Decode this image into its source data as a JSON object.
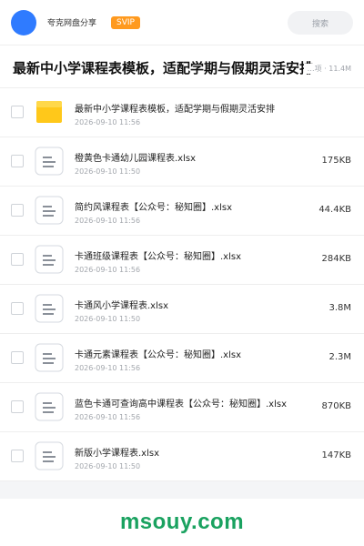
{
  "header": {
    "app_name": "夸克网盘分享",
    "badge": "SVIP",
    "search_label": "搜索"
  },
  "share": {
    "title": "最新中小学课程表模板，适配学期与假期灵活安排",
    "meta": "…项 · 11.4M"
  },
  "files": [
    {
      "icon": "folder-icon",
      "name": "最新中小学课程表模板，适配学期与假期灵活安排",
      "date": "2026-09-10 11:56",
      "size": ""
    },
    {
      "icon": "spreadsheet-file-icon",
      "name": "橙黄色卡通幼儿园课程表.xlsx",
      "date": "2026-09-10 11:50",
      "size": "175KB"
    },
    {
      "icon": "spreadsheet-file-icon",
      "name": "简约风课程表【公众号：秘知圈】.xlsx",
      "date": "2026-09-10 11:56",
      "size": "44.4KB"
    },
    {
      "icon": "spreadsheet-file-icon",
      "name": "卡通班级课程表【公众号：秘知圈】.xlsx",
      "date": "2026-09-10 11:56",
      "size": "284KB"
    },
    {
      "icon": "spreadsheet-file-icon",
      "name": "卡通风小学课程表.xlsx",
      "date": "2026-09-10 11:50",
      "size": "3.8M"
    },
    {
      "icon": "spreadsheet-file-icon",
      "name": "卡通元素课程表【公众号：秘知圈】.xlsx",
      "date": "2026-09-10 11:56",
      "size": "2.3M"
    },
    {
      "icon": "spreadsheet-file-icon",
      "name": "蓝色卡通可查询高中课程表【公众号：秘知圈】.xlsx",
      "date": "2026-09-10 11:56",
      "size": "870KB"
    },
    {
      "icon": "spreadsheet-file-icon",
      "name": "新版小学课程表.xlsx",
      "date": "2026-09-10 11:50",
      "size": "147KB"
    }
  ],
  "watermark": "msouy.com",
  "colors": {
    "accent": "#2f7bff",
    "svip": "#ff9a1f",
    "folder": "#ffc81a",
    "watermark": "#1aa260"
  }
}
